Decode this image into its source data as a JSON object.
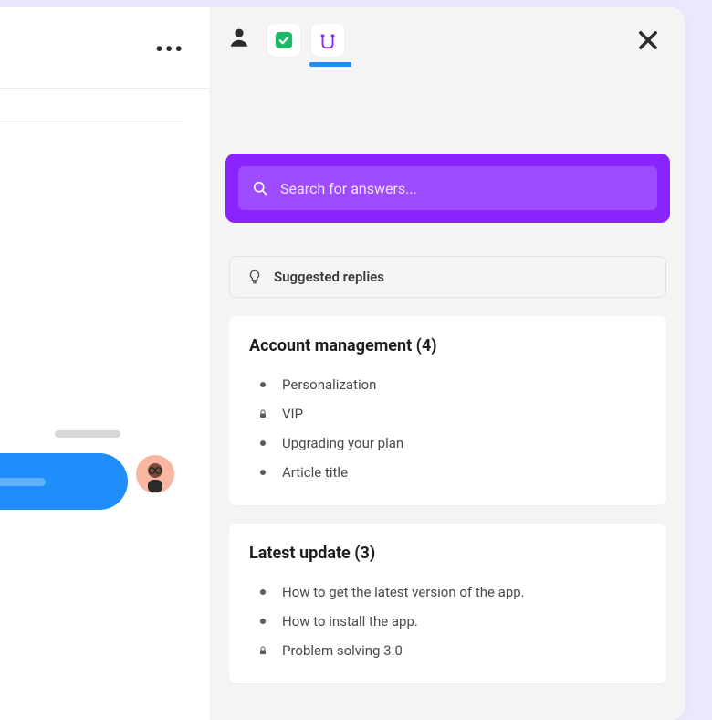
{
  "chat": {
    "more_label": "•••"
  },
  "search": {
    "placeholder": "Search for answers..."
  },
  "suggested": {
    "label": "Suggested replies"
  },
  "sections": [
    {
      "title": "Account management (4)",
      "items": [
        {
          "label": "Personalization",
          "locked": false
        },
        {
          "label": "VIP",
          "locked": true
        },
        {
          "label": "Upgrading your plan",
          "locked": false
        },
        {
          "label": "Article title",
          "locked": false
        }
      ]
    },
    {
      "title": "Latest update (3)",
      "items": [
        {
          "label": "How to get the latest version of the app.",
          "locked": false
        },
        {
          "label": "How to install the app.",
          "locked": false
        },
        {
          "label": "Problem solving 3.0",
          "locked": true
        }
      ]
    }
  ]
}
